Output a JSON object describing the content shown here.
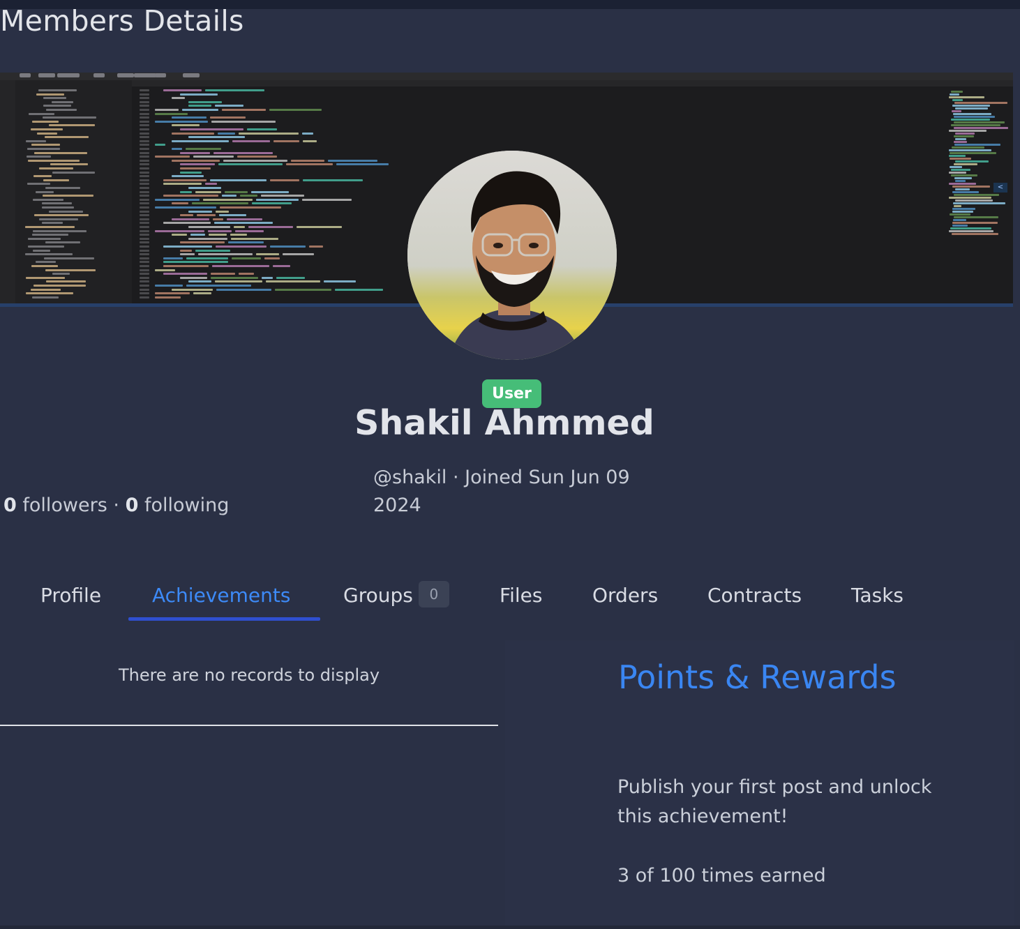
{
  "page": {
    "title": "Members Details"
  },
  "cover": {
    "description_icon": "code-editor-screenshot",
    "collapse_glyph": "<"
  },
  "profile": {
    "avatar_icon": "avatar-photo",
    "role_badge": "User",
    "name": "Shakil Ahmmed",
    "handle": "@shakil",
    "separator": "·",
    "joined": "Joined Sun Jun 09 2024",
    "followers_count": "0",
    "followers_label": "followers",
    "following_count": "0",
    "following_label": "following"
  },
  "tabs": [
    {
      "label": "Profile",
      "active": false
    },
    {
      "label": "Achievements",
      "active": true
    },
    {
      "label": "Groups",
      "count": "0",
      "active": false
    },
    {
      "label": "Files",
      "active": false
    },
    {
      "label": "Orders",
      "active": false
    },
    {
      "label": "Contracts",
      "active": false
    },
    {
      "label": "Tasks",
      "active": false
    }
  ],
  "achievements": {
    "empty_message": "There are no records to display"
  },
  "rewards": {
    "title": "Points & Rewards",
    "description": "Publish your first post and unlock this achievement!",
    "earned": "3 of 100 times earned"
  },
  "colors": {
    "background": "#2a3045",
    "accent_blue": "#3a86f2",
    "tab_underline": "#2f4fd0",
    "badge_green": "#46bd78"
  }
}
